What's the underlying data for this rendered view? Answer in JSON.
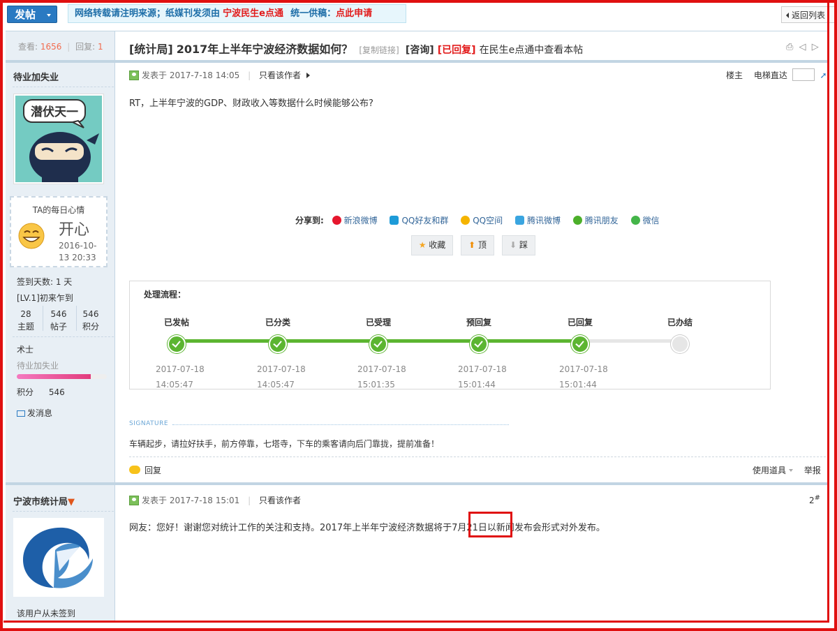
{
  "topbar": {
    "post_button": "发帖",
    "notice_part1": "网络转载请注明来源；纸媒刊发须由",
    "notice_link1": "宁波民生e点通",
    "notice_part2": "统一供稿：",
    "notice_link2": "点此申请",
    "back_button": "返回列表"
  },
  "thread": {
    "views_label": "查看:",
    "views": "1656",
    "replies_label": "回复:",
    "replies": "1",
    "tag": "[统计局]",
    "title": "2017年上半年宁波经济数据如何？",
    "copy_link": "[复制链接]",
    "type": "[咨询]",
    "status": "[已回复]",
    "app_link": "在民生e点通中查看本帖"
  },
  "post1": {
    "author": "待业加失业",
    "avatar_text": "潜伏天一",
    "mood_title": "TA的每日心情",
    "mood": "开心",
    "mood_date": "2016-10-13 20:33",
    "checkin_days": "签到天数: 1 天",
    "level": "[LV.1]初来乍到",
    "stats": [
      {
        "value": "28",
        "label": "主题"
      },
      {
        "value": "546",
        "label": "帖子"
      },
      {
        "value": "546",
        "label": "积分"
      }
    ],
    "rank": "术士",
    "rank_sub": "待业加失业",
    "rank_progress": 0.82,
    "credit_label": "积分",
    "credit": "546",
    "pm": "发消息",
    "posted": "发表于 2017-7-18 14:05",
    "only_author": "只看该作者",
    "floor_label": "楼主",
    "lift_label": "电梯直达",
    "content": "RT，上半年宁波的GDP、财政收入等数据什么时候能够公布?",
    "share_label": "分享到:",
    "share": [
      {
        "name": "新浪微博",
        "icon": "weibo-icon",
        "color": "#e6162d"
      },
      {
        "name": "QQ好友和群",
        "icon": "qq-icon",
        "color": "#1d9bd8"
      },
      {
        "name": "QQ空间",
        "icon": "qzone-icon",
        "color": "#f5b400"
      },
      {
        "name": "腾讯微博",
        "icon": "tencent-weibo-icon",
        "color": "#3aa5e0"
      },
      {
        "name": "腾讯朋友",
        "icon": "clover-icon",
        "color": "#4caf2a"
      },
      {
        "name": "微信",
        "icon": "wechat-icon",
        "color": "#44b549"
      }
    ],
    "actions": {
      "favorite": "收藏",
      "up": "顶",
      "down": "踩"
    },
    "process_title": "处理流程：",
    "steps": [
      {
        "name": "已发帖",
        "date": "2017-07-18",
        "time": "14:05:47",
        "done": true
      },
      {
        "name": "已分类",
        "date": "2017-07-18",
        "time": "14:05:47",
        "done": true
      },
      {
        "name": "已受理",
        "date": "2017-07-18",
        "time": "15:01:35",
        "done": true
      },
      {
        "name": "预回复",
        "date": "2017-07-18",
        "time": "15:01:44",
        "done": true
      },
      {
        "name": "已回复",
        "date": "2017-07-18",
        "time": "15:01:44",
        "done": true
      },
      {
        "name": "已办结",
        "date": "",
        "time": "",
        "done": false
      }
    ],
    "signature_label": "SIGNATURE",
    "signature": "车辆起步，请拉好扶手，前方停靠，七塔寺，下车的乘客请向后门靠拢，提前准备！",
    "reply": "回复",
    "tools": "使用道具",
    "report": "举报"
  },
  "post2": {
    "author": "宁波市统计局",
    "posted": "发表于 2017-7-18 15:01",
    "only_author": "只看该作者",
    "floor": "2",
    "floor_mark": "#",
    "content_before": "网友：您好！谢谢您对统计工作的关注和支持。2017年上半年宁波经济数据将于",
    "content_highlight": "7月21日",
    "content_after": "以新闻发布会形式对外发布。",
    "no_checkin": "该用户从未签到"
  }
}
